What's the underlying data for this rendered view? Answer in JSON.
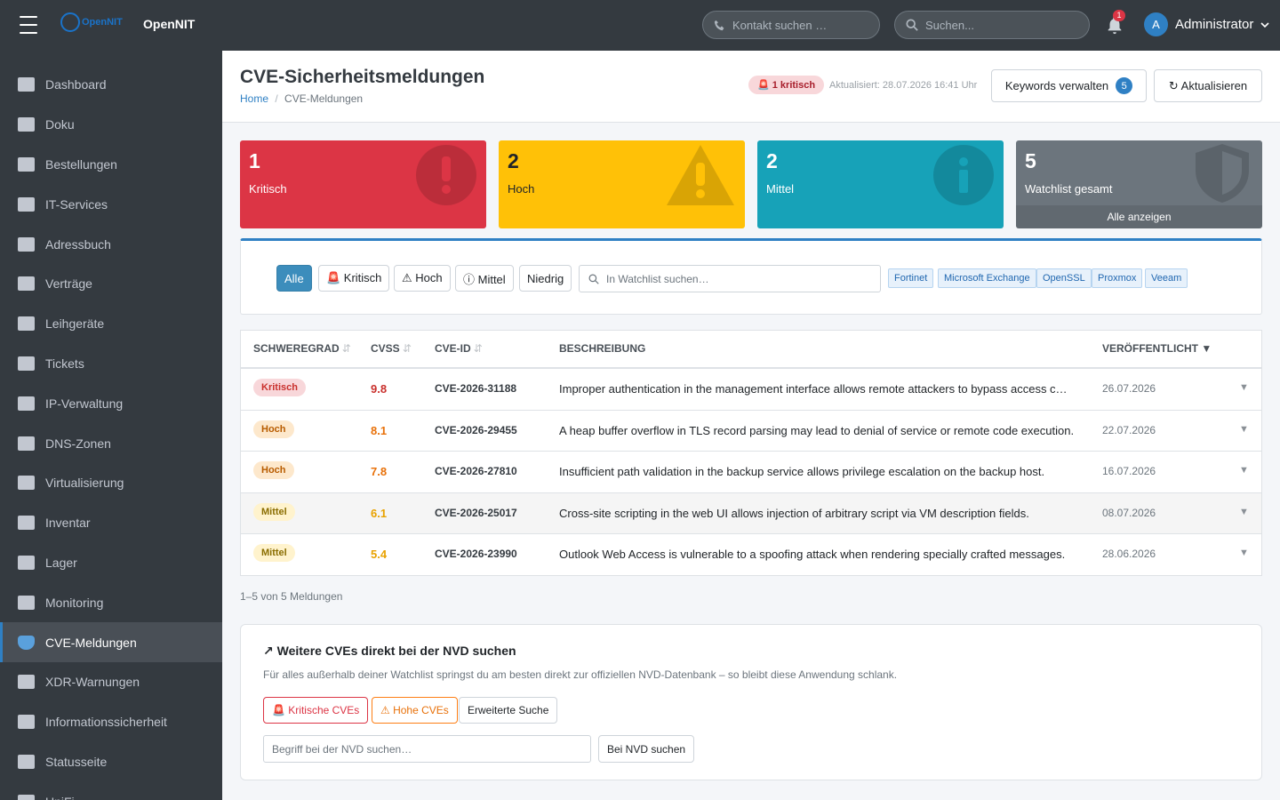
{
  "topbar": {
    "logo_text": "OpenNIT",
    "brand": "OpenNIT",
    "contact_search_placeholder": "Kontakt suchen …",
    "search_placeholder": "Suchen...",
    "notifications_count": "1",
    "user_initial": "A",
    "user_name": "Administrator"
  },
  "sidebar": {
    "items": [
      {
        "label": "Dashboard",
        "icon": "home-icon"
      },
      {
        "label": "Doku",
        "icon": "book-icon"
      },
      {
        "label": "Bestellungen",
        "icon": "cart-icon"
      },
      {
        "label": "IT-Services",
        "icon": "gear-icon"
      },
      {
        "label": "Adressbuch",
        "icon": "address-book-icon"
      },
      {
        "label": "Verträge",
        "icon": "contract-icon"
      },
      {
        "label": "Leihgeräte",
        "icon": "laptop-icon"
      },
      {
        "label": "Tickets",
        "icon": "ticket-icon"
      },
      {
        "label": "IP-Verwaltung",
        "icon": "globe-icon"
      },
      {
        "label": "DNS-Zonen",
        "icon": "sitemap-icon"
      },
      {
        "label": "Virtualisierung",
        "icon": "server-icon"
      },
      {
        "label": "Inventar",
        "icon": "boxes-icon"
      },
      {
        "label": "Lager",
        "icon": "warehouse-icon"
      },
      {
        "label": "Monitoring",
        "icon": "chart-line-icon"
      },
      {
        "label": "CVE-Meldungen",
        "icon": "shield-icon",
        "active": true
      },
      {
        "label": "XDR-Warnungen",
        "icon": "shield-virus-icon"
      },
      {
        "label": "Informationssicherheit",
        "icon": "user-lock-icon"
      },
      {
        "label": "Statusseite",
        "icon": "traffic-light-icon"
      },
      {
        "label": "UniFi",
        "icon": "wifi-icon"
      }
    ]
  },
  "header": {
    "title": "CVE-Sicherheitsmeldungen",
    "breadcrumb_home": "Home",
    "breadcrumb_sep": "/",
    "breadcrumb_current": "CVE-Meldungen",
    "critical_badge": "🚨 1 kritisch",
    "updated": "Aktualisiert: 28.07.2026 16:41 Uhr",
    "keywords_label": "Keywords verwalten",
    "keywords_count": "5",
    "refresh_label": "↻ Aktualisieren"
  },
  "cards": [
    {
      "count": "1",
      "label": "Kritisch",
      "color": "#dc3545",
      "icon": "exclamation-circle-icon"
    },
    {
      "count": "2",
      "label": "Hoch",
      "color": "#ffc107",
      "icon": "warning-triangle-icon"
    },
    {
      "count": "2",
      "label": "Mittel",
      "color": "#17a2b8",
      "icon": "info-circle-icon"
    },
    {
      "count": "5",
      "label": "Watchlist gesamt",
      "color": "#6c757d",
      "icon": "shield-icon",
      "footer": "Alle anzeigen"
    }
  ],
  "filters": {
    "buttons": [
      "Alle",
      "🚨 Kritisch",
      "⚠ Hoch",
      "ⓘ Mittel",
      "Niedrig"
    ],
    "search_placeholder": "In Watchlist suchen…",
    "keywords": [
      "Fortinet",
      "Microsoft Exchange",
      "OpenSSL",
      "Proxmox",
      "Veeam"
    ]
  },
  "table": {
    "columns": [
      "SCHWEREGRAD",
      "CVSS",
      "CVE-ID",
      "BESCHREIBUNG",
      "VERÖFFENTLICHT ▼"
    ],
    "rows": [
      {
        "severity": "Kritisch",
        "cvss": "9.8",
        "id": "CVE-2026-31188",
        "desc": "Improper authentication in the management interface allows remote attackers to bypass access c…",
        "date": "26.07.2026"
      },
      {
        "severity": "Hoch",
        "cvss": "8.1",
        "id": "CVE-2026-29455",
        "desc": "A heap buffer overflow in TLS record parsing may lead to denial of service or remote code execution.",
        "date": "22.07.2026"
      },
      {
        "severity": "Hoch",
        "cvss": "7.8",
        "id": "CVE-2026-27810",
        "desc": "Insufficient path validation in the backup service allows privilege escalation on the backup host.",
        "date": "16.07.2026"
      },
      {
        "severity": "Mittel",
        "cvss": "6.1",
        "id": "CVE-2026-25017",
        "desc": "Cross-site scripting in the web UI allows injection of arbitrary script via VM description fields.",
        "date": "08.07.2026"
      },
      {
        "severity": "Mittel",
        "cvss": "5.4",
        "id": "CVE-2026-23990",
        "desc": "Outlook Web Access is vulnerable to a spoofing attack when rendering specially crafted messages.",
        "date": "28.06.2026"
      }
    ],
    "pager": "1–5 von 5 Meldungen"
  },
  "nvd": {
    "title": "↗ Weitere CVEs direkt bei der NVD suchen",
    "text": "Für alles außerhalb deiner Watchlist springst du am besten direkt zur offiziellen NVD-Datenbank – so bleibt diese Anwendung schlank.",
    "btn_critical": "🚨 Kritische CVEs",
    "btn_high": "⚠ Hohe CVEs",
    "btn_advanced": "Erweiterte Suche",
    "input_placeholder": "Begriff bei der NVD suchen…",
    "btn_search": "Bei NVD suchen"
  },
  "colors": {
    "critical": "#dc3545",
    "high": "#ffc107",
    "medium": "#17a2b8",
    "watchlist": "#6c757d",
    "accent": "#3c8dbc",
    "sidebar": "#343a40"
  }
}
